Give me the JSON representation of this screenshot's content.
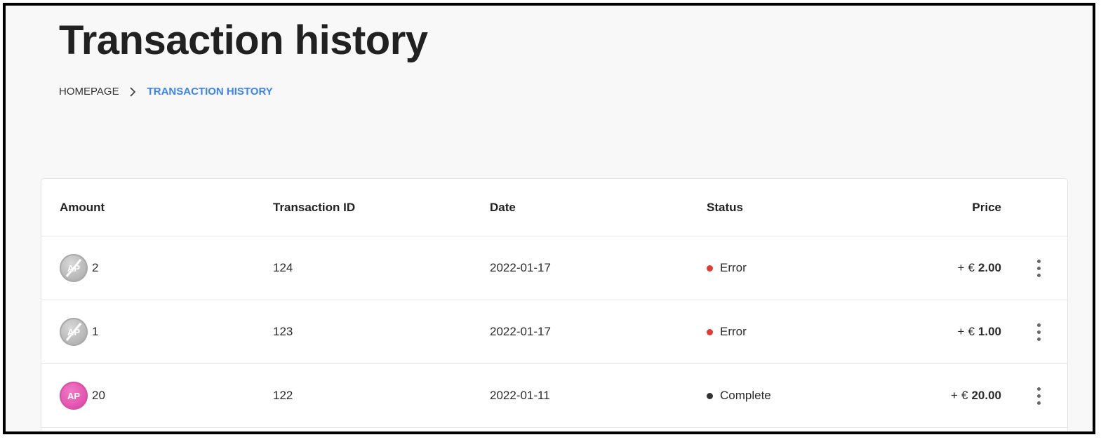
{
  "page": {
    "title": "Transaction history"
  },
  "breadcrumb": {
    "home": "HOMEPAGE",
    "current": "TRANSACTION HISTORY"
  },
  "table": {
    "headers": {
      "amount": "Amount",
      "transaction_id": "Transaction ID",
      "date": "Date",
      "status": "Status",
      "price": "Price"
    },
    "rows": [
      {
        "coin_label": "AP",
        "coin_style": "disabled",
        "amount": "2",
        "transaction_id": "124",
        "date": "2022-01-17",
        "status": "Error",
        "status_color": "#e53935",
        "price_prefix": "+",
        "currency": "€",
        "price": "2.00"
      },
      {
        "coin_label": "AP",
        "coin_style": "disabled",
        "amount": "1",
        "transaction_id": "123",
        "date": "2022-01-17",
        "status": "Error",
        "status_color": "#e53935",
        "price_prefix": "+",
        "currency": "€",
        "price": "1.00"
      },
      {
        "coin_label": "AP",
        "coin_style": "active",
        "amount": "20",
        "transaction_id": "122",
        "date": "2022-01-11",
        "status": "Complete",
        "status_color": "#333333",
        "price_prefix": "+",
        "currency": "€",
        "price": "20.00"
      }
    ]
  },
  "colors": {
    "accent": "#3b82f6",
    "coin_active": "#e355b0",
    "coin_disabled": "#b8b8b8"
  },
  "icons": {
    "breadcrumb_separator": "chevron-right-icon",
    "row_menu": "more-vertical-icon",
    "coin": "ap-coin-icon"
  }
}
